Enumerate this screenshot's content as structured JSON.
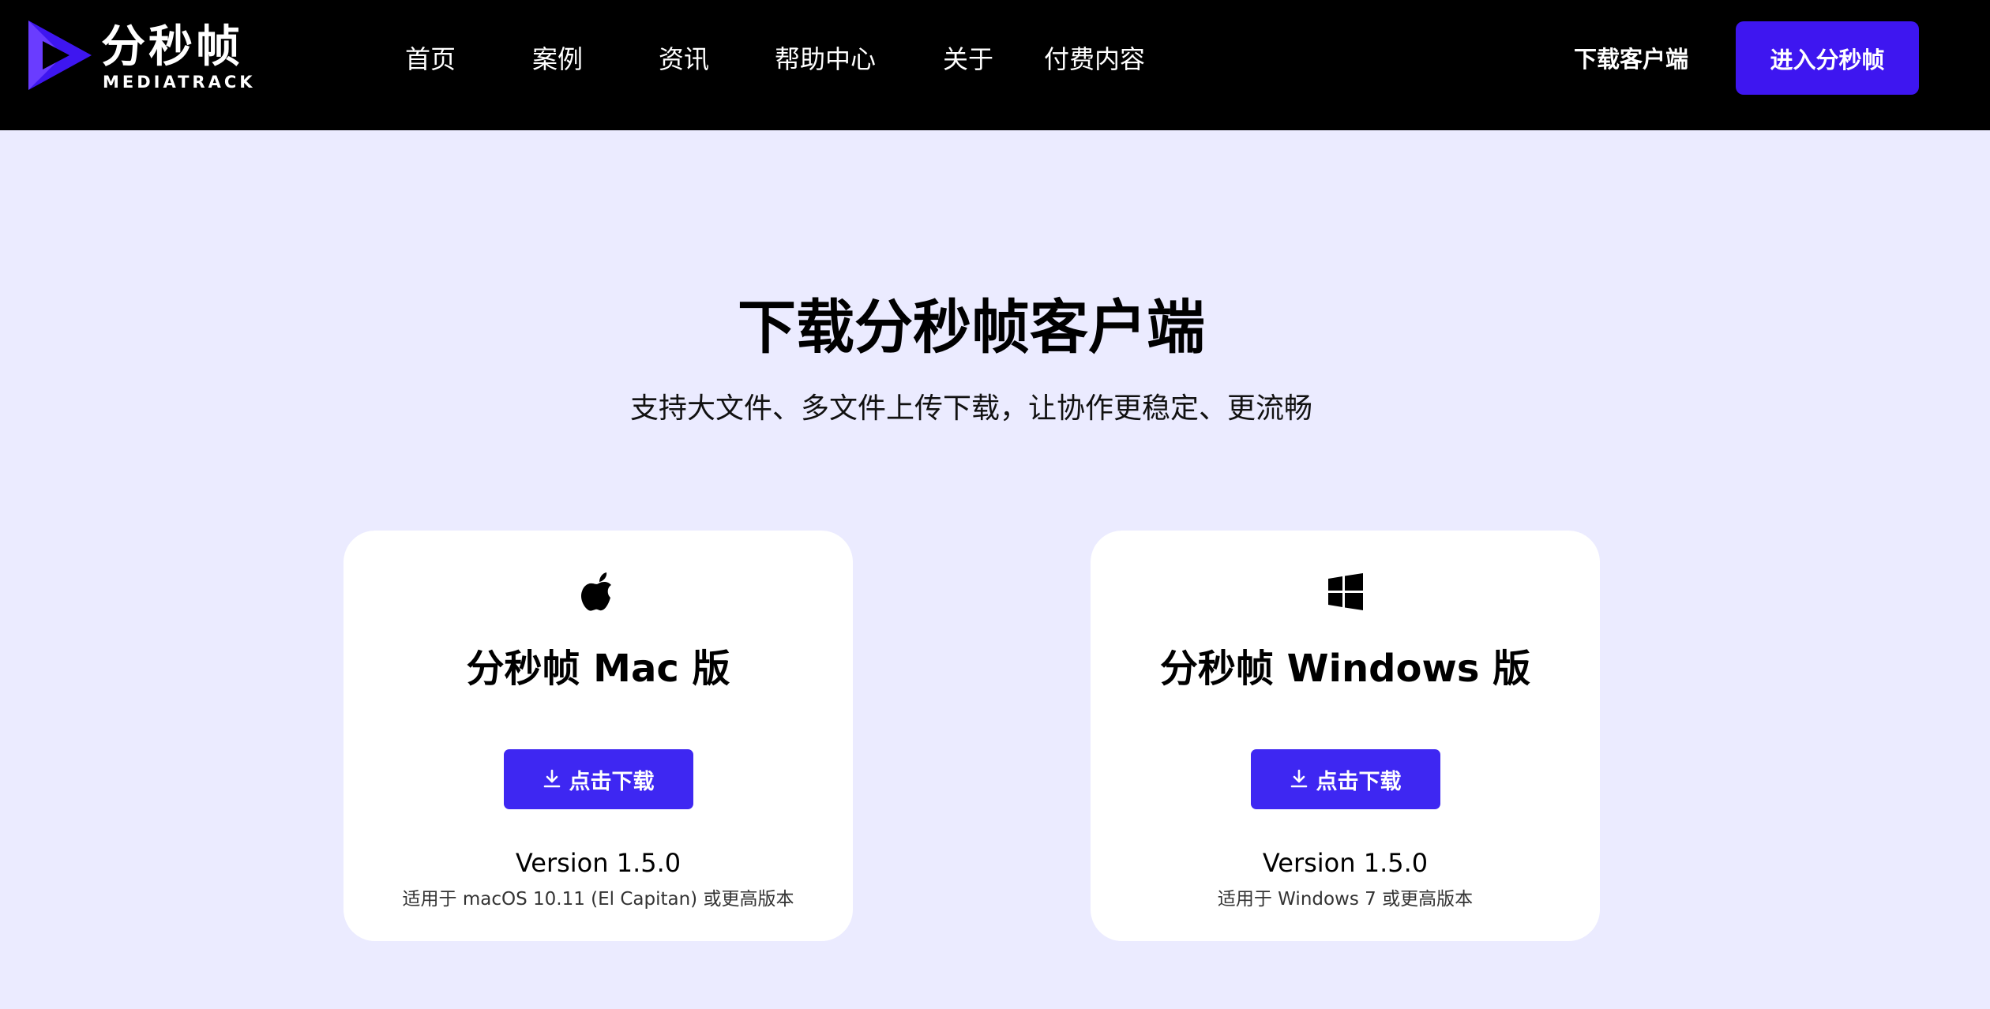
{
  "header": {
    "logo_cn": "分秒帧",
    "logo_en": "MEDIATRACK",
    "nav": [
      "首页",
      "案例",
      "资讯",
      "帮助中心",
      "关于",
      "付费内容"
    ],
    "client_link": "下载客户端",
    "enter_button": "进入分秒帧"
  },
  "hero": {
    "title": "下载分秒帧客户端",
    "subtitle": "支持大文件、多文件上传下载，让协作更稳定、更流畅"
  },
  "cards": [
    {
      "icon": "apple-icon",
      "title": "分秒帧 Mac 版",
      "button": "点击下载",
      "version": "Version 1.5.0",
      "compat": "适用于 macOS 10.11 (El Capitan) 或更高版本"
    },
    {
      "icon": "windows-icon",
      "title": "分秒帧 Windows 版",
      "button": "点击下载",
      "version": "Version 1.5.0",
      "compat": "适用于 Windows 7 或更高版本"
    }
  ],
  "colors": {
    "header_bg": "#000000",
    "page_bg": "#ebebff",
    "accent": "#3e16f0",
    "button": "#3e27f2"
  }
}
